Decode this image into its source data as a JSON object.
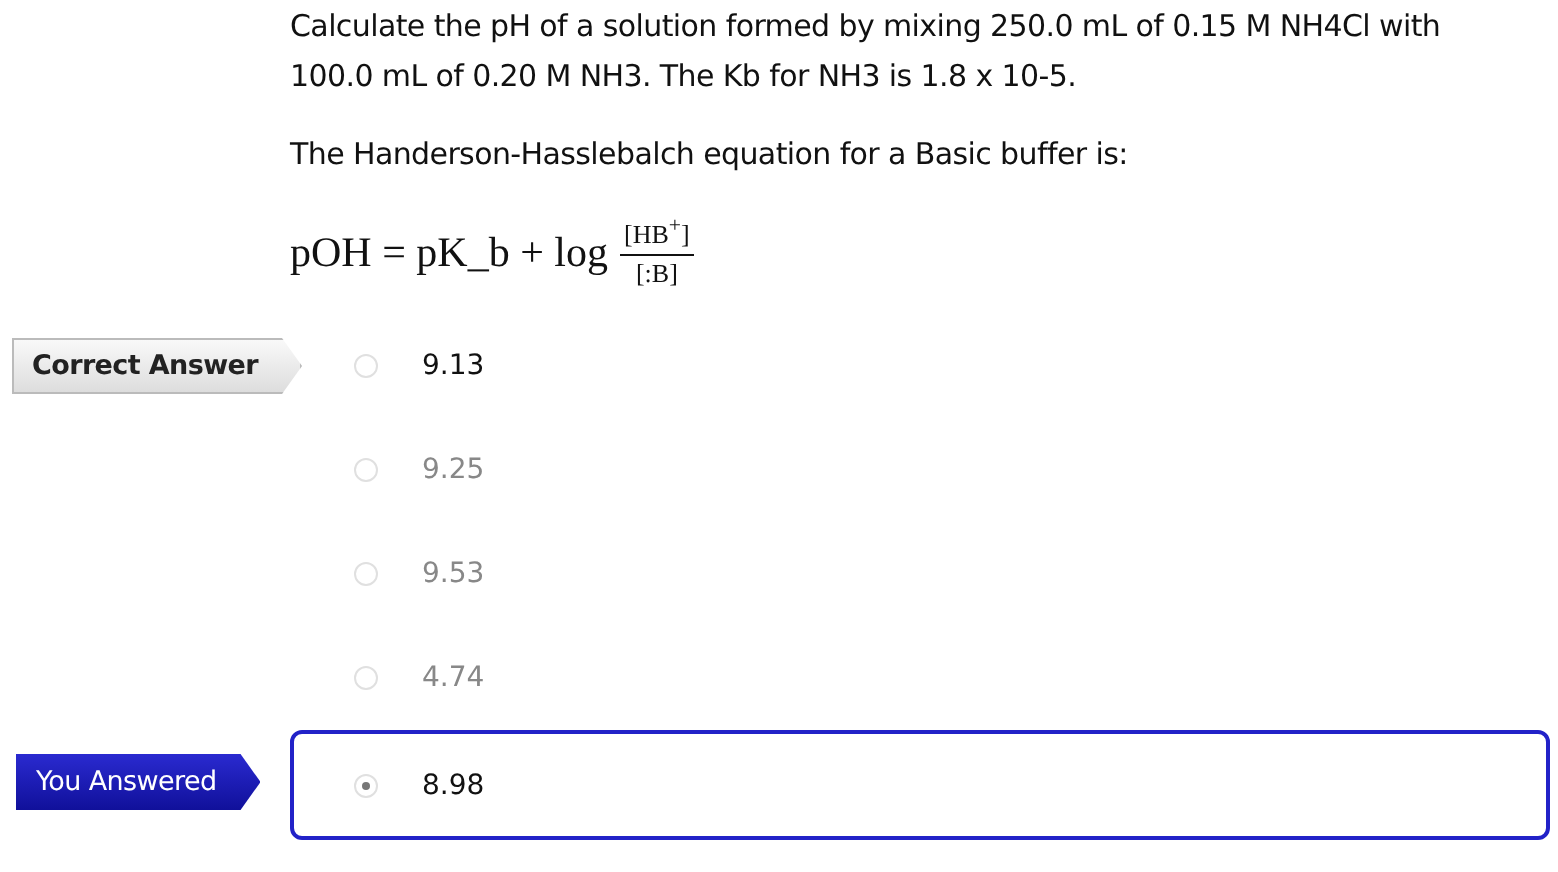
{
  "question": {
    "paragraphs": [
      "Calculate the pH of a solution formed by mixing 250.0 mL of 0.15 M NH4Cl with 100.0 mL of 0.20 M NH3. The Kb for NH3 is 1.8 x 10-5.",
      "The Handerson-Hasslebalch equation for a Basic buffer is:"
    ],
    "formula": {
      "lhs": "pOH = pK_b + log",
      "numerator": "[HB$^{+}$]",
      "denominator": "[:B]"
    }
  },
  "options": [
    {
      "value": "9.13",
      "selected": false,
      "correct": true,
      "tag": {
        "kind": "correct",
        "label": "Correct Answer"
      }
    },
    {
      "value": "9.25",
      "selected": false,
      "correct": false
    },
    {
      "value": "9.53",
      "selected": false,
      "correct": false
    },
    {
      "value": "4.74",
      "selected": false,
      "correct": false
    },
    {
      "value": "8.98",
      "selected": true,
      "correct": false,
      "tag": {
        "kind": "answered",
        "label": "You Answered"
      }
    }
  ]
}
